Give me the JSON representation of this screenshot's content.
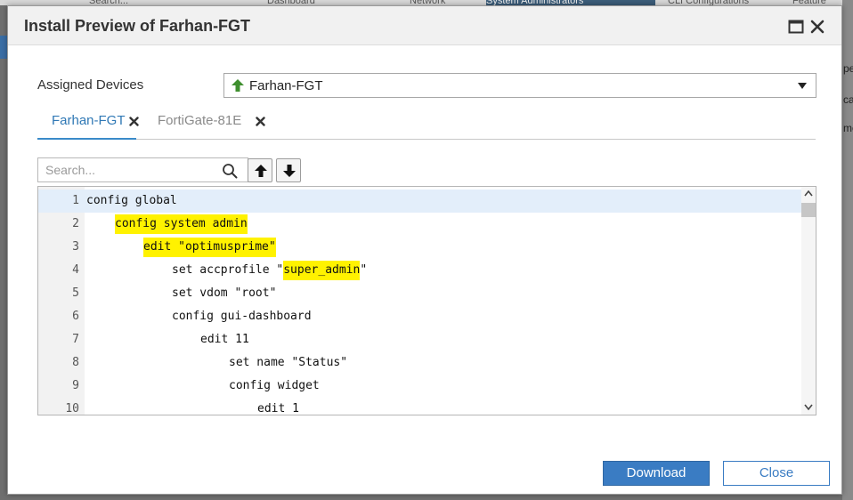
{
  "dialog": {
    "title": "Install Preview of Farhan-FGT"
  },
  "assigned_devices": {
    "label": "Assigned Devices",
    "selected": "Farhan-FGT"
  },
  "tabs": [
    {
      "label": "Farhan-FGT",
      "active": true
    },
    {
      "label": "FortiGate-81E",
      "active": false
    }
  ],
  "search": {
    "placeholder": "Search...",
    "value": ""
  },
  "code": {
    "lines": [
      {
        "n": "1",
        "indent": 0,
        "pre": "config global",
        "hl": "",
        "post": ""
      },
      {
        "n": "2",
        "indent": 1,
        "pre": "",
        "hl": "config system admin",
        "post": ""
      },
      {
        "n": "3",
        "indent": 2,
        "pre": "",
        "hl": "edit \"optimusprime\"",
        "post": ""
      },
      {
        "n": "4",
        "indent": 3,
        "pre": "set accprofile \"",
        "hl": "super_admin",
        "post": "\""
      },
      {
        "n": "5",
        "indent": 3,
        "pre": "set vdom \"root\"",
        "hl": "",
        "post": ""
      },
      {
        "n": "6",
        "indent": 3,
        "pre": "config gui-dashboard",
        "hl": "",
        "post": ""
      },
      {
        "n": "7",
        "indent": 4,
        "pre": "edit 11",
        "hl": "",
        "post": ""
      },
      {
        "n": "8",
        "indent": 5,
        "pre": "set name \"Status\"",
        "hl": "",
        "post": ""
      },
      {
        "n": "9",
        "indent": 5,
        "pre": "config widget",
        "hl": "",
        "post": ""
      },
      {
        "n": "10",
        "indent": 6,
        "pre": "edit 1",
        "hl": "",
        "post": ""
      }
    ]
  },
  "footer": {
    "download_label": "Download",
    "close_label": "Close"
  },
  "background": {
    "tabs": [
      "Search...",
      "Dashboard",
      "Network",
      "System Administrators",
      "CLI Configurations",
      "Feature"
    ],
    "right_fragments": [
      "pe",
      "ca",
      "me"
    ]
  },
  "colors": {
    "accent": "#3a7cc3",
    "highlight": "#fff200",
    "active_tab": "#2f78b5",
    "up_arrow": "#3f8f2f"
  },
  "icons": {
    "device_status": "green-up-arrow-icon",
    "maximize": "maximize-icon",
    "close": "close-icon",
    "search": "search-icon",
    "prev": "arrow-up-icon",
    "next": "arrow-down-icon"
  }
}
